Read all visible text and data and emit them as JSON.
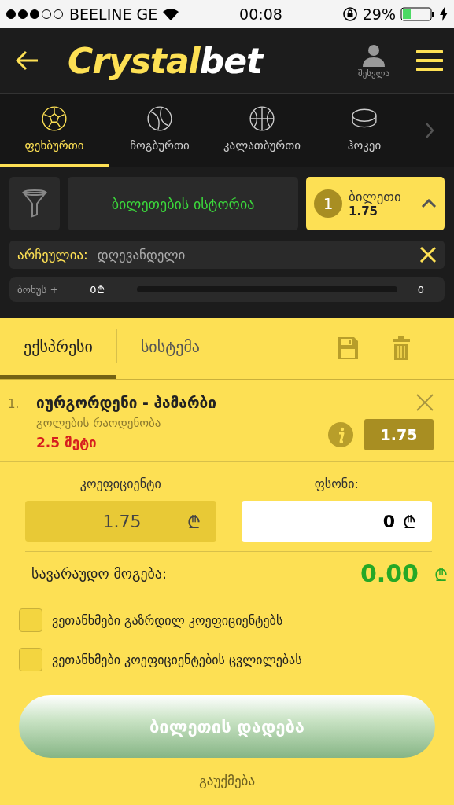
{
  "status_bar": {
    "carrier": "BEELINE GE",
    "time": "00:08",
    "battery": "29%"
  },
  "header": {
    "logo_main": "Crystal",
    "logo_accent": "bet",
    "login": "შესვლა"
  },
  "sports": [
    {
      "label": "ფეხბურთი",
      "kind": "football",
      "selected": true
    },
    {
      "label": "ჩოგბურთი",
      "kind": "tennis",
      "selected": false
    },
    {
      "label": "კალათბურთი",
      "kind": "basketball",
      "selected": false
    },
    {
      "label": "ჰოკეი",
      "kind": "hockey",
      "selected": false
    }
  ],
  "toolbar": {
    "history": "ბილეთების ისტორია",
    "ticket_count": "1",
    "ticket_label": "ბილეთი",
    "ticket_odds": "1.75"
  },
  "filter": {
    "label": "არჩეულია:",
    "value": "დღევანდელი"
  },
  "bonus": {
    "label": "ბონუს +",
    "amount": "0₾",
    "level": 0,
    "count": "0"
  },
  "slip_tabs": [
    {
      "label": "ექსპრესი",
      "selected": true
    },
    {
      "label": "სისტემა",
      "selected": false
    }
  ],
  "bets": [
    {
      "number": "1.",
      "match": "იურგორდენი - ჰამარბი",
      "market": "გოლების რაოდენობა",
      "pick": "2.5 მეტი",
      "odds": "1.75"
    }
  ],
  "odds_field": {
    "label": "კოეფიციენტი",
    "value": "1.75",
    "currency": "₾"
  },
  "stake_field": {
    "label": "ფსონი:",
    "value": "0",
    "currency": "₾"
  },
  "win": {
    "label": "სავარაუდო მოგება:",
    "value": "0.00",
    "currency": "₾"
  },
  "agreements": [
    {
      "label": "ვეთანხმები გაზრდილ კოეფიციენტებს",
      "checked": false
    },
    {
      "label": "ვეთანხმები კოეფიციენტების ცვლილებას",
      "checked": false
    }
  ],
  "place_button": "ბილეთის დადება",
  "cancel": "გაუქმება"
}
